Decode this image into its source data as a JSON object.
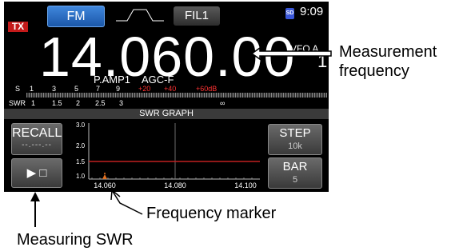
{
  "screen": {
    "tx_indicator": "TX",
    "mode": "FM",
    "filter": "FIL1",
    "sd_icon": "SD",
    "clock": "9:09",
    "frequency": "14.060.00",
    "vfo_label": "VFO A",
    "vfo_number": "1",
    "preamp": "P.AMP1",
    "agc": "AGC-F",
    "meter": {
      "s_label": "S",
      "s_ticks": [
        "1",
        "3",
        "5",
        "7",
        "9"
      ],
      "s_red_ticks": [
        "+20",
        "+40",
        "+60dB"
      ],
      "swr_label": "SWR",
      "swr_ticks": [
        "1",
        "1.5",
        "2",
        "2.5",
        "3",
        "∞"
      ]
    },
    "swr_graph": {
      "title": "SWR GRAPH",
      "recall_label": "RECALL",
      "recall_value": "--.---.--",
      "play_icon": "play-stop-icon",
      "step_label": "STEP",
      "step_value": "10k",
      "bar_label": "BAR",
      "bar_value": "5"
    }
  },
  "chart_data": {
    "type": "line",
    "x_tick_labels": [
      "14.060",
      "14.080",
      "14.100"
    ],
    "y_tick_labels": [
      "1.0",
      "1.5",
      "2.0",
      "3.0"
    ],
    "reference_line_swr": 1.5,
    "marker_frequency": "14.060",
    "colors": {
      "reference_line": "#c02020",
      "marker": "#e07020",
      "grid": "#888888"
    }
  },
  "callouts": {
    "measurement_frequency": [
      "Measurement",
      "frequency"
    ],
    "frequency_marker": "Frequency marker",
    "measuring_swr": "Measuring SWR"
  },
  "colors": {
    "screen_bg": "#000000",
    "tx": "#c41a1a",
    "mode_button": "#2a6cc4"
  }
}
